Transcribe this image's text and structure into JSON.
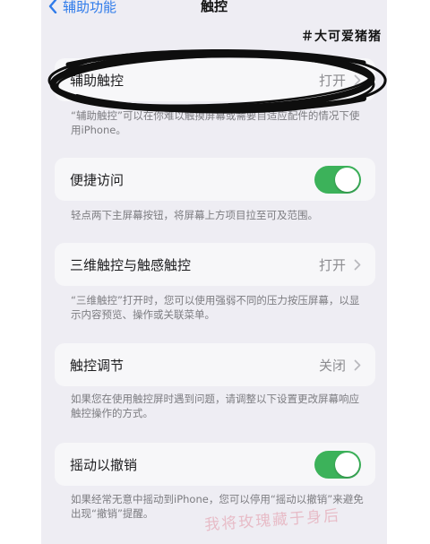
{
  "nav": {
    "back_label": "辅助功能",
    "title": "触控"
  },
  "watermark_top": "＃大可爱猪猪",
  "rows": [
    {
      "label": "辅助触控",
      "value": "打开"
    },
    {
      "label": "便捷访问",
      "toggle": true
    },
    {
      "label": "三维触控与触感触控",
      "value": "打开"
    },
    {
      "label": "触控调节",
      "value": "关闭"
    },
    {
      "label": "摇动以撤销",
      "toggle": true
    }
  ],
  "footers": [
    "“辅助触控”可以在你难以触摸屏幕或需要自适应配件的情况下使用iPhone。",
    "轻点两下主屏幕按钮，将屏幕上方项目拉至可及范围。",
    "“三维触控”打开时，您可以使用强弱不同的压力按压屏幕，以显示内容预览、操作或关联菜单。",
    "如果您在使用触控屏时遇到问题，请调整以下设置更改屏幕响应触控操作的方式。",
    "如果经常无意中摇动到iPhone，您可以停用“摇动以撤销”来避免出现“撤销”提醒。"
  ],
  "handwritten_watermark": "我将玫瑰藏于身后",
  "colors": {
    "accent": "#2f7bea",
    "toggle_on": "#3cb25a",
    "background": "#eeedf3"
  },
  "icons": {
    "back": "chevron-left-icon",
    "disclosure": "chevron-right-icon"
  }
}
